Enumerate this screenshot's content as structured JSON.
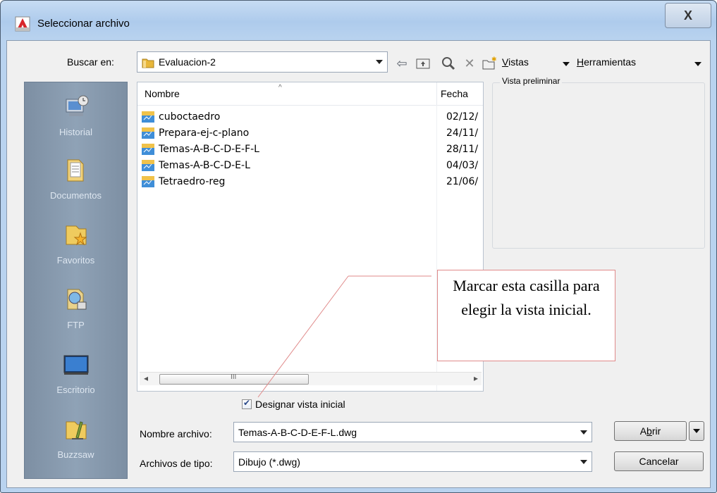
{
  "window": {
    "title": "Seleccionar archivo",
    "close_label": "X"
  },
  "toolbar": {
    "lookin_label": "Buscar en:",
    "lookin_value": "Evaluacion-2",
    "views_prefix": "V",
    "views_rest": "istas",
    "tools_prefix": "H",
    "tools_rest": "erramientas"
  },
  "places": [
    {
      "label": "Historial",
      "icon": "history-icon"
    },
    {
      "label": "Documentos",
      "icon": "documents-folder-icon"
    },
    {
      "label": "Favoritos",
      "icon": "favorites-folder-icon"
    },
    {
      "label": "FTP",
      "icon": "ftp-icon"
    },
    {
      "label": "Escritorio",
      "icon": "desktop-icon"
    },
    {
      "label": "Buzzsaw",
      "icon": "buzzsaw-icon"
    }
  ],
  "filelist": {
    "columns": {
      "name": "Nombre",
      "date": "Fecha"
    },
    "files": [
      {
        "name": "cuboctaedro",
        "date": "02/12/"
      },
      {
        "name": "Prepara-ej-c-plano",
        "date": "24/11/"
      },
      {
        "name": "Temas-A-B-C-D-E-F-L",
        "date": "28/11/"
      },
      {
        "name": "Temas-A-B-C-D-E-L",
        "date": "04/03/"
      },
      {
        "name": "Tetraedro-reg",
        "date": "21/06/"
      }
    ]
  },
  "preview": {
    "title": "Vista preliminar"
  },
  "callout": {
    "text": "Marcar esta casilla para elegir la vista inicial."
  },
  "initial_view": {
    "label": "Designar vista inicial",
    "checked": true
  },
  "filename": {
    "label": "Nombre archivo:",
    "value": "Temas-A-B-C-D-E-F-L.dwg"
  },
  "filetype": {
    "label": "Archivos de tipo:",
    "value": "Dibujo (*.dwg)"
  },
  "buttons": {
    "open_a": "A",
    "open_b": "b",
    "open_rest": "rir",
    "cancel": "Cancelar"
  },
  "colors": {
    "accent": "#f0c24a",
    "callout_border": "#e08a8a"
  }
}
